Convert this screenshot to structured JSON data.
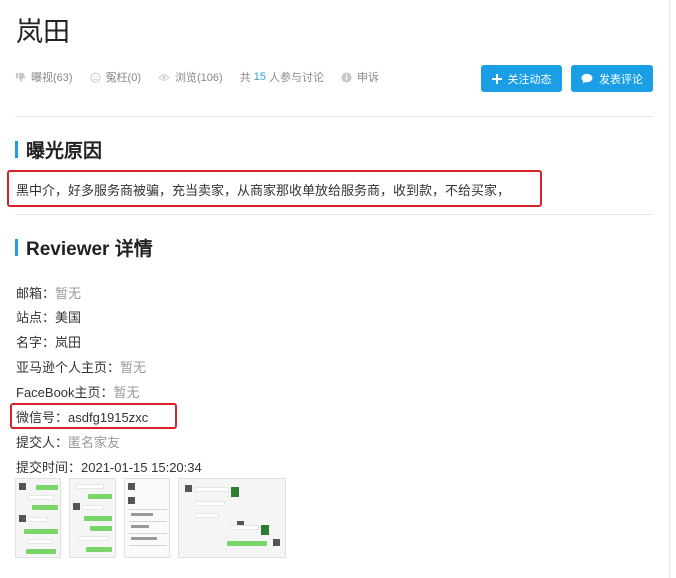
{
  "page": {
    "title": "岚田"
  },
  "stats": {
    "exposure": "曝视(63)",
    "wronged": "冤枉(0)",
    "views": "浏览(106)",
    "discussion_prefix": "共",
    "discussion_count": "15",
    "discussion_suffix": "人参与讨论",
    "appeal": "申诉"
  },
  "actions": {
    "follow_label": "关注动态",
    "comment_label": "发表评论"
  },
  "reason": {
    "heading": "曝光原因",
    "text": "黑中介，好多服务商被骗，充当卖家，从商家那收单放给服务商，收到款，不给买家，"
  },
  "reviewer": {
    "heading": "Reviewer 详情",
    "email_label": "邮箱：",
    "email_value": "暂无",
    "site_label": "站点：",
    "site_value": "美国",
    "name_label": "名字：",
    "name_value": "岚田",
    "amazon_label": "亚马逊个人主页：",
    "amazon_value": "暂无",
    "facebook_label": "FaceBook主页：",
    "facebook_value": "暂无",
    "wechat_label": "微信号：",
    "wechat_value": "asdfg1915zxc",
    "submitter_label": "提交人：",
    "submitter_value": "匿名家友",
    "submit_time_label": "提交时间：",
    "submit_time_value": "2021-01-15 15:20:34"
  },
  "colors": {
    "accent": "#1a9ee6",
    "highlight_box": "#d8232a"
  },
  "icons": {
    "exposure": "thumbs-down-icon",
    "wronged": "sad-face-icon",
    "views": "eye-icon",
    "appeal": "info-icon",
    "follow": "plus-icon",
    "comment": "chat-bubble-icon"
  }
}
